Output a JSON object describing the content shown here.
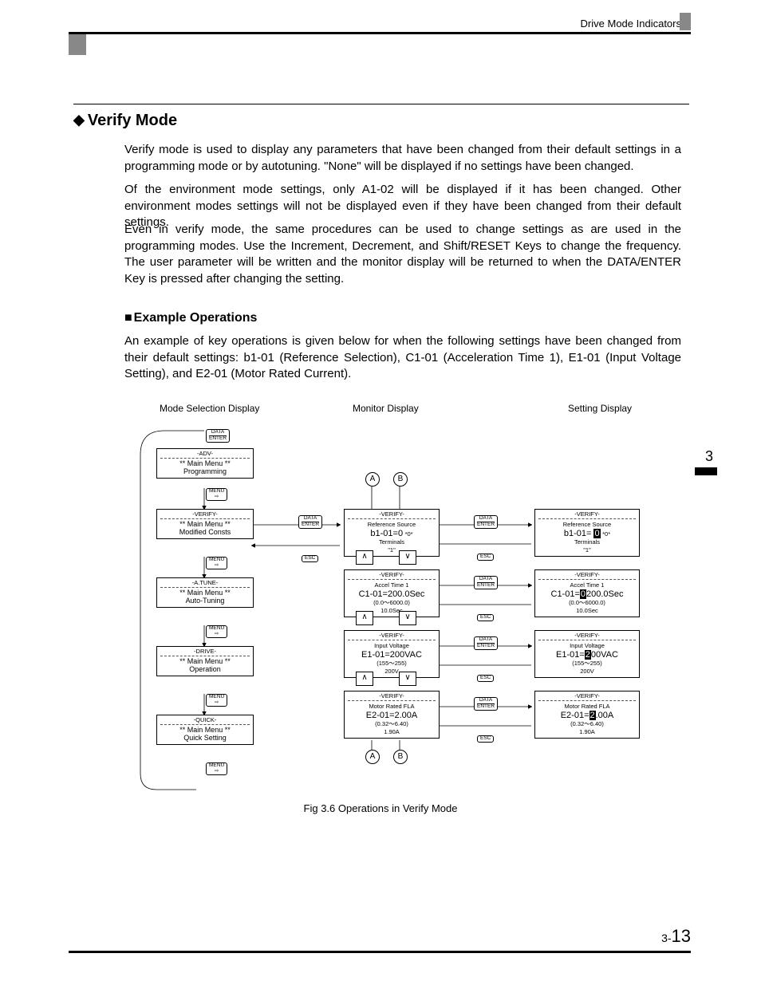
{
  "header": {
    "running_head": "Drive Mode Indicators",
    "side_chapter": "3",
    "page_number_prefix": "3-",
    "page_number": "13"
  },
  "section": {
    "title": "Verify Mode",
    "para1": "Verify mode is used to display any parameters that have been changed from their default settings in a programming mode or by autotuning. \"None\" will be displayed if no settings have been changed.",
    "para2": "Of the environment mode settings, only A1-02 will be displayed if it has been changed. Other environment modes settings will not be displayed even if they have been changed from their default settings.",
    "para3": "Even in verify mode, the same procedures can be used to change settings as are used in the programming modes. Use the Increment, Decrement, and Shift/RESET Keys to change the frequency. The user parameter will be written and the monitor display will be returned to when the DATA/ENTER Key is pressed after changing the setting."
  },
  "subsection": {
    "title": "Example Operations",
    "para1": "An example of key operations is given below for when the following settings have been changed from their default settings: b1-01 (Reference Selection), C1-01 (Acceleration Time 1), E1-01 (Input Voltage Setting), and E2-01 (Motor Rated Current)."
  },
  "columns": {
    "col1": "Mode Selection Display",
    "col2": "Monitor Display",
    "col3": "Setting Display"
  },
  "keys": {
    "data_enter_top": "DATA",
    "data_enter_bot": "ENTER",
    "menu": "MENU",
    "esc": "ESC"
  },
  "mode_panels": [
    {
      "tag": "-ADV-",
      "l1": "** Main Menu **",
      "l2": "Programming"
    },
    {
      "tag": "-VERIFY-",
      "l1": "** Main Menu **",
      "l2": "Modified Consts"
    },
    {
      "tag": "-A.TUNE-",
      "l1": "** Main Menu **",
      "l2": "Auto-Tuning"
    },
    {
      "tag": "-DRIVE-",
      "l1": "** Main Menu **",
      "l2": "Operation"
    },
    {
      "tag": "-QUICK-",
      "l1": "** Main Menu **",
      "l2": "Quick Setting"
    }
  ],
  "monitor_panels": [
    {
      "tag": "-VERIFY-",
      "title": "Reference Source",
      "big": "b1-01=0",
      "mark": "*0*",
      "sm1": "Terminals",
      "sm2": "\"1\""
    },
    {
      "tag": "-VERIFY-",
      "title": "Accel Time 1",
      "big": "C1-01=200.0Sec",
      "mark": "",
      "sm1": "(0.0～6000.0)",
      "sm2": "10.0Sec"
    },
    {
      "tag": "-VERIFY-",
      "title": "Input Voltage",
      "big": "E1-01=200VAC",
      "mark": "",
      "sm1": "(155～255)",
      "sm2": "200V"
    },
    {
      "tag": "-VERIFY-",
      "title": "Motor Rated FLA",
      "big": "E2-01=2.00A",
      "mark": "",
      "sm1": "(0.32～6.40)",
      "sm2": "1.90A"
    }
  ],
  "setting_panels": [
    {
      "tag": "-VERIFY-",
      "title": "Reference Source",
      "big": "b1-01= 0",
      "hl": "0",
      "mark": "*0*",
      "sm1": "Terminals",
      "sm2": "\"1\""
    },
    {
      "tag": "-VERIFY-",
      "title": "Accel Time 1",
      "big": "C1-01=0200.0Sec",
      "hl": "0",
      "mark": "",
      "sm1": "(0.0～6000.0)",
      "sm2": "10.0Sec"
    },
    {
      "tag": "-VERIFY-",
      "title": "Input Voltage",
      "big": "E1-01=200VAC",
      "hl": "2",
      "mark": "",
      "sm1": "(155～255)",
      "sm2": "200V"
    },
    {
      "tag": "-VERIFY-",
      "title": "Motor Rated FLA",
      "big": "E2-01=2.00A",
      "hl": "2",
      "mark": "",
      "sm1": "(0.32～6.40)",
      "sm2": "1.90A"
    }
  ],
  "circle_labels": {
    "a": "A",
    "b": "B"
  },
  "caption": "Fig 3.6  Operations in Verify Mode"
}
